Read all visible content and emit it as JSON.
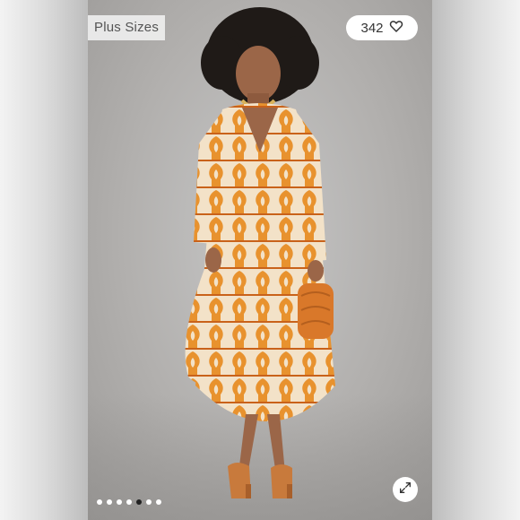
{
  "listing": {
    "tag_label": "Plus Sizes",
    "like_count": "342",
    "like_icon": "heart-outline-icon",
    "expand_icon": "expand-diagonal-icon"
  },
  "carousel": {
    "slide_count": 7,
    "active_index": 3
  },
  "colors": {
    "backdrop": "#b4b2b0",
    "dress_primary": "#e8922e",
    "dress_secondary": "#f3e2c8",
    "dress_accent": "#c9621a",
    "bag": "#d9782a",
    "sandals": "#c87a3c",
    "hair": "#1f1a17",
    "skin": "#9b6648"
  }
}
